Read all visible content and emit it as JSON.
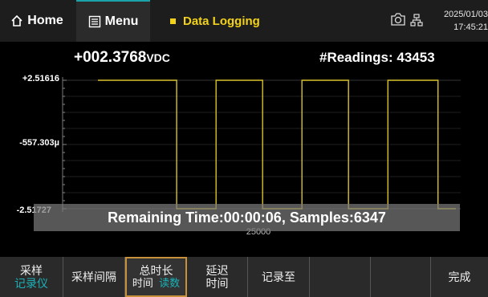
{
  "topbar": {
    "home_label": "Home",
    "menu_label": "Menu",
    "mode_label": "Data Logging",
    "date": "2025/01/03",
    "time": "17:45:21",
    "icons": [
      "home-icon",
      "menu-icon",
      "camera-icon",
      "network-icon"
    ]
  },
  "readout": {
    "value": "+002.3768",
    "unit": "VDC",
    "readings_label": "#Readings:",
    "readings_count": "43453"
  },
  "plot": {
    "ytop": "+2.51616",
    "ymid": "-557.303µ",
    "ybot": "-2.51727",
    "xlabel": "25000",
    "trace_color": "#d9c22e"
  },
  "chart_data": {
    "type": "line",
    "title": "",
    "xlabel": "",
    "ylabel": "",
    "y_ticks": [
      "+2.51616",
      "-557.303µ",
      "-2.51727"
    ],
    "x_ticks": [
      "25000"
    ],
    "series": [
      {
        "x": [
          0,
          0.22,
          0.22,
          0.33,
          0.33,
          0.46,
          0.46,
          0.57,
          0.57,
          0.7,
          0.7,
          0.81,
          0.81,
          0.95,
          0.95,
          1
        ],
        "values": [
          2.51616,
          2.51616,
          -2.51727,
          -2.51727,
          2.51616,
          2.51616,
          -2.51727,
          -2.51727,
          2.51616,
          2.51616,
          -2.51727,
          -2.51727,
          2.51616,
          2.51616,
          -2.51727,
          -2.51727
        ]
      }
    ]
  },
  "overlay": {
    "remaining_label": "Remaining Time: ",
    "remaining_value": "00:00:06",
    "samples_label": ", Samples: ",
    "samples_value": "6347"
  },
  "softkeys": [
    {
      "line1": "采样",
      "line2": "记录仪"
    },
    {
      "line1": "采样间隔",
      "line2": ""
    },
    {
      "line1": "总时长",
      "line2a": "时间",
      "line2b": "读数"
    },
    {
      "line1": "延迟",
      "line2": "时间"
    },
    {
      "line1": "记录至",
      "line2": ""
    },
    {
      "line1": "",
      "line2": ""
    },
    {
      "line1": "",
      "line2": ""
    },
    {
      "line1": "完成",
      "line2": ""
    }
  ]
}
